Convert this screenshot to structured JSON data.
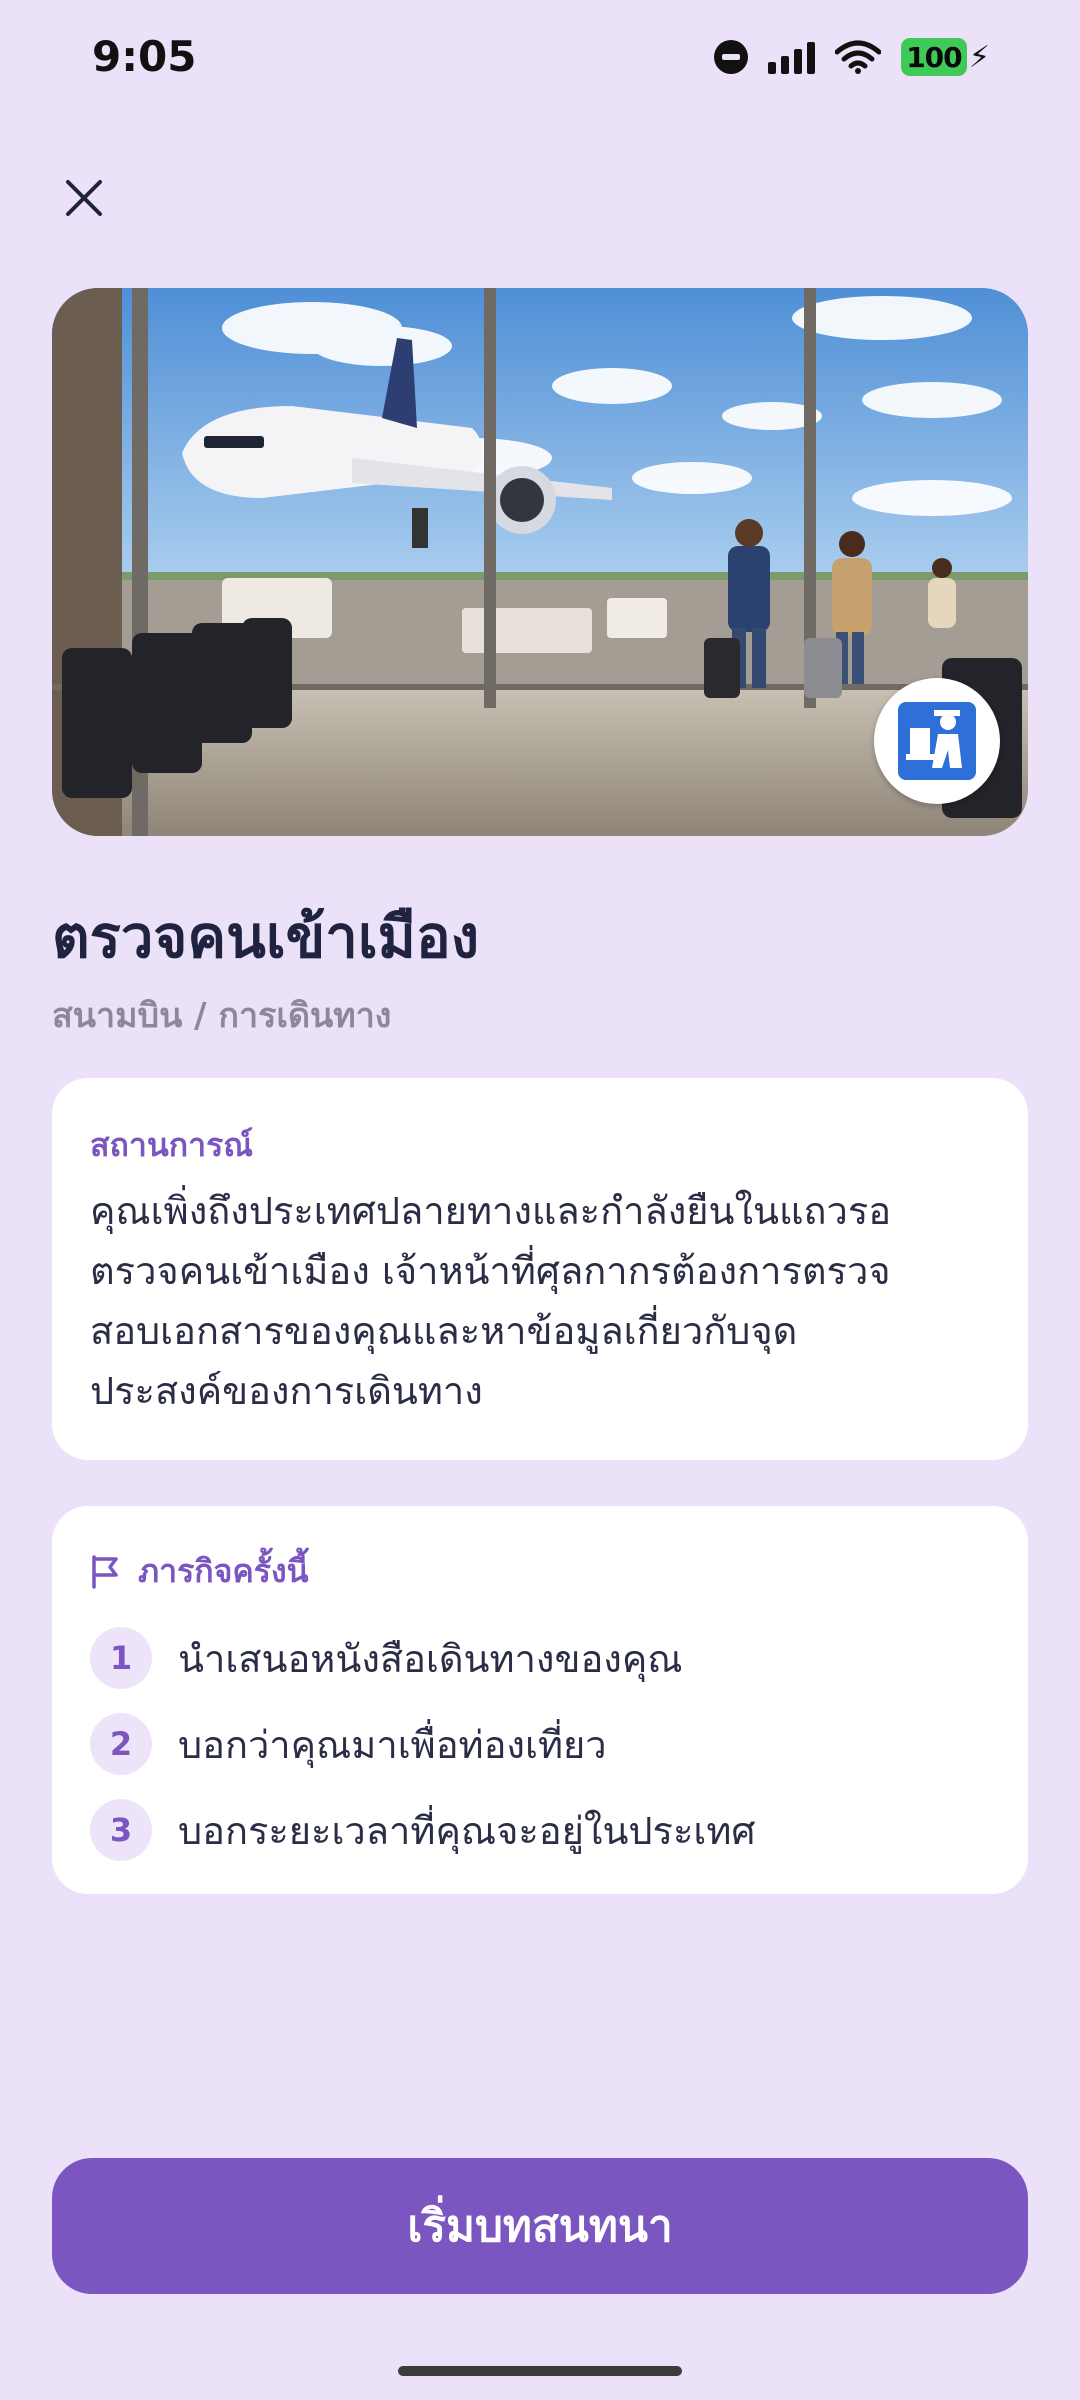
{
  "status_bar": {
    "time": "9:05",
    "battery": "100"
  },
  "icons": {
    "close": "close-icon",
    "flag": "flag-icon",
    "badge": "immigration-officer-icon"
  },
  "colors": {
    "background": "#ebe1f8",
    "accent": "#7b55c0",
    "card": "#ffffff",
    "title": "#1f2340",
    "muted": "#8b879c"
  },
  "lesson": {
    "title": "ตรวจคนเข้าเมือง",
    "category": "สนามบิน / การเดินทาง"
  },
  "scenario": {
    "label": "สถานการณ์",
    "lines": [
      "คุณเพิ่งถึงประเทศปลายทางและกำลังยืนในแถวรอ",
      "ตรวจคนเข้าเมือง เจ้าหน้าที่ศุลกากรต้องการตรวจ",
      "สอบเอกสารของคุณและหาข้อมูลเกี่ยวกับจุด",
      "ประสงค์ของการเดินทาง"
    ]
  },
  "mission": {
    "label": "ภารกิจครั้งนี้",
    "items": [
      {
        "number": "1",
        "text": "นำเสนอหนังสือเดินทางของคุณ"
      },
      {
        "number": "2",
        "text": "บอกว่าคุณมาเพื่อท่องเที่ยว"
      },
      {
        "number": "3",
        "text": "บอกระยะเวลาที่คุณจะอยู่ในประเทศ"
      }
    ]
  },
  "actions": {
    "start_label": "เริ่มบทสนทนา"
  }
}
